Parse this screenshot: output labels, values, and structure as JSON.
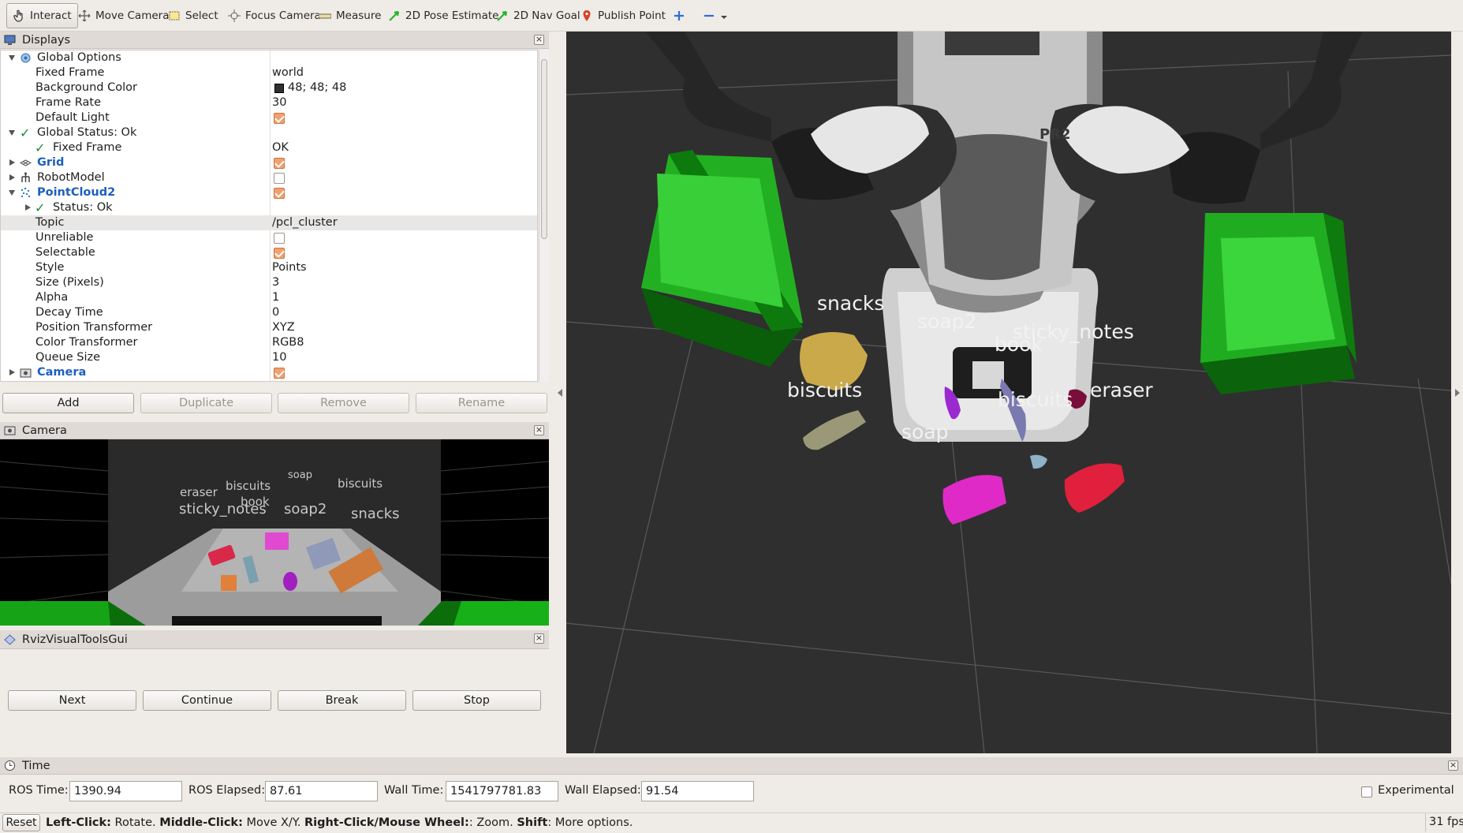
{
  "toolbar": {
    "tools": [
      {
        "label": "Interact",
        "icon": "hand-cursor-icon"
      },
      {
        "label": "Move Camera",
        "icon": "move-camera-icon"
      },
      {
        "label": "Select",
        "icon": "select-box-icon"
      },
      {
        "label": "Focus Camera",
        "icon": "crosshair-icon"
      },
      {
        "label": "Measure",
        "icon": "ruler-icon"
      },
      {
        "label": "2D Pose Estimate",
        "icon": "green-arrow-icon"
      },
      {
        "label": "2D Nav Goal",
        "icon": "green-arrow-icon"
      },
      {
        "label": "Publish Point",
        "icon": "map-pin-icon"
      }
    ]
  },
  "displays": {
    "title": "Displays",
    "rows": [
      {
        "name": "Global Options",
        "value": ""
      },
      {
        "name": "Fixed Frame",
        "value": "world"
      },
      {
        "name": "Background Color",
        "value": "48; 48; 48"
      },
      {
        "name": "Frame Rate",
        "value": "30"
      },
      {
        "name": "Default Light",
        "value": ""
      },
      {
        "name": "Global Status: Ok",
        "value": ""
      },
      {
        "name": "Fixed Frame",
        "value": "OK"
      },
      {
        "name": "Grid",
        "value": ""
      },
      {
        "name": "RobotModel",
        "value": ""
      },
      {
        "name": "PointCloud2",
        "value": ""
      },
      {
        "name": "Status: Ok",
        "value": ""
      },
      {
        "name": "Topic",
        "value": "/pcl_cluster"
      },
      {
        "name": "Unreliable",
        "value": ""
      },
      {
        "name": "Selectable",
        "value": ""
      },
      {
        "name": "Style",
        "value": "Points"
      },
      {
        "name": "Size (Pixels)",
        "value": "3"
      },
      {
        "name": "Alpha",
        "value": "1"
      },
      {
        "name": "Decay Time",
        "value": "0"
      },
      {
        "name": "Position Transformer",
        "value": "XYZ"
      },
      {
        "name": "Color Transformer",
        "value": "RGB8"
      },
      {
        "name": "Queue Size",
        "value": "10"
      },
      {
        "name": "Camera",
        "value": ""
      }
    ],
    "background_swatch": "#303030",
    "buttons": {
      "add": "Add",
      "duplicate": "Duplicate",
      "remove": "Remove",
      "rename": "Rename"
    }
  },
  "camera_panel": {
    "title": "Camera",
    "labels": [
      "eraser",
      "biscuits",
      "soap",
      "biscuits",
      "book",
      "sticky_notes",
      "soap2",
      "snacks"
    ]
  },
  "visual_tools": {
    "title": "RvizVisualToolsGui",
    "buttons": {
      "next": "Next",
      "continue": "Continue",
      "break": "Break",
      "stop": "Stop"
    }
  },
  "viewport": {
    "labels": [
      "snacks",
      "soap2",
      "sticky_notes",
      "book",
      "biscuits",
      "biscuits",
      "eraser",
      "soap"
    ],
    "robot_label": "PR2"
  },
  "time_panel": {
    "title": "Time",
    "ros_time_label": "ROS Time:",
    "ros_time": "1390.94",
    "ros_elapsed_label": "ROS Elapsed:",
    "ros_elapsed": "87.61",
    "wall_time_label": "Wall Time:",
    "wall_time": "1541797781.83",
    "wall_elapsed_label": "Wall Elapsed:",
    "wall_elapsed": "91.54",
    "experimental_label": "Experimental"
  },
  "status_bar": {
    "reset": "Reset",
    "hint_left_key": "Left-Click:",
    "hint_left": " Rotate. ",
    "hint_middle_key": "Middle-Click:",
    "hint_middle": " Move X/Y. ",
    "hint_right_key": "Right-Click/Mouse Wheel:",
    "hint_right": ": Zoom. ",
    "hint_shift_key": "Shift",
    "hint_shift": ": More options.",
    "fps": "31 fps"
  }
}
